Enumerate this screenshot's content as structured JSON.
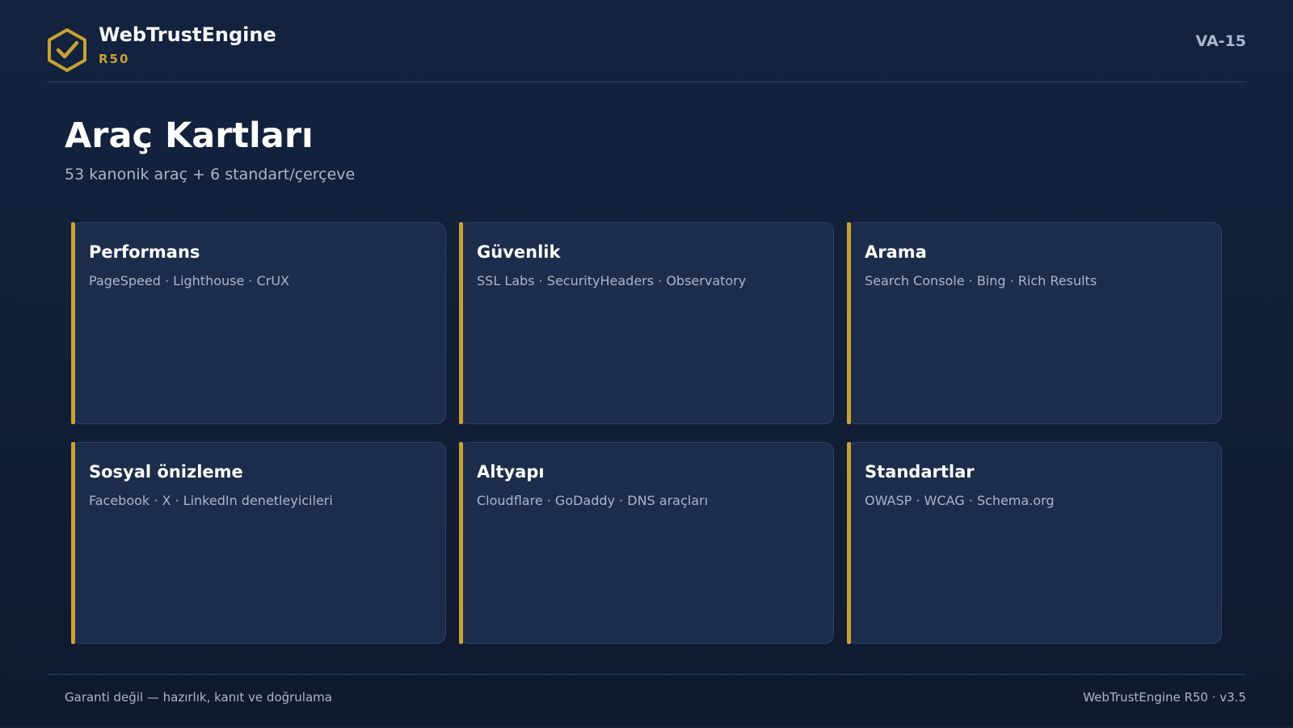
{
  "header": {
    "logo_icon": "hexagon-check-icon",
    "brand_name": "WebTrustEngine",
    "brand_version": "R50",
    "slide_code": "VA-15"
  },
  "main": {
    "title": "Araç Kartları",
    "subtitle": "53 kanonik araç + 6 standart/çerçeve"
  },
  "cards": [
    {
      "title": "Performans",
      "tools": "PageSpeed · Lighthouse · CrUX"
    },
    {
      "title": "Güvenlik",
      "tools": "SSL Labs · SecurityHeaders · Observatory"
    },
    {
      "title": "Arama",
      "tools": "Search Console · Bing · Rich Results"
    },
    {
      "title": "Sosyal önizleme",
      "tools": "Facebook · X · LinkedIn denetleyicileri"
    },
    {
      "title": "Altyapı",
      "tools": "Cloudflare · GoDaddy · DNS araçları"
    },
    {
      "title": "Standartlar",
      "tools": "OWASP · WCAG · Schema.org"
    }
  ],
  "footer": {
    "disclaimer": "Garanti değil — hazırlık, kanıt ve doğrulama",
    "version": "WebTrustEngine R50 · v3.5"
  },
  "colors": {
    "background": "#13233f",
    "card": "#1b2d4b",
    "accent": "#c9a034",
    "muted_text": "#aab6c9"
  }
}
